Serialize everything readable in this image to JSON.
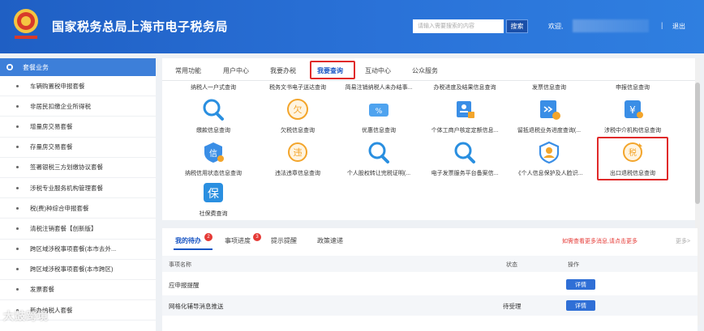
{
  "header": {
    "title": "国家税务总局上海市电子税务局",
    "search_placeholder": "请输入需要搜索的内容",
    "search_button": "搜索",
    "welcome": "欢迎,",
    "separator": "|",
    "logout": "退出",
    "brand_color": "#2a72d8"
  },
  "sidebar": {
    "header": "套餐业务",
    "items": [
      "车辆购置税申报套餐",
      "非居民扣缴企业所得税",
      "增量房交易套餐",
      "存量房交易套餐",
      "签署银税三方划缴协议套餐",
      "涉税专业服务机构管理套餐",
      "税(费)种综合申报套餐",
      "清税注销套餐【创新版】",
      "跨区域涉税事项套餐(本市去外...",
      "跨区域涉税事项套餐(本市跨区)",
      "发票套餐",
      "新办纳税人套餐"
    ]
  },
  "main_tabs": {
    "items": [
      "常用功能",
      "用户中心",
      "我要办税",
      "我要查询",
      "互动中心",
      "公众服务"
    ],
    "active": "我要查询"
  },
  "query_grid": {
    "row1_labels": [
      "纳税人一户式查询",
      "税务文书电子送达查询",
      "简易注销纳税人未办结事...",
      "办税进度及结果信息查询",
      "发票信息查询",
      "申报信息查询"
    ],
    "row2": [
      {
        "label": "缴款信息查询",
        "icon": "search-icon"
      },
      {
        "label": "欠税信息查询",
        "icon": "owed-tax-icon"
      },
      {
        "label": "优惠信息查询",
        "icon": "discount-icon"
      },
      {
        "label": "个体工商户核定定额信息...",
        "icon": "business-license-icon"
      },
      {
        "label": "留抵退税业务进度查询(...",
        "icon": "tax-refund-progress-icon"
      },
      {
        "label": "涉税中介机构信息查询",
        "icon": "agency-icon"
      }
    ],
    "row3": [
      {
        "label": "纳税信用状态信息查询",
        "icon": "credit-icon"
      },
      {
        "label": "违法违章信息查询",
        "icon": "violation-icon"
      },
      {
        "label": "个人股权转让完税证明(...",
        "icon": "search-icon"
      },
      {
        "label": "电子发票服务平台备案信...",
        "icon": "search-icon"
      },
      {
        "label": "《个人信息保护及人脸识...",
        "icon": "face-id-icon"
      },
      {
        "label": "出口退税信息查询",
        "icon": "export-refund-icon"
      }
    ],
    "row4": [
      {
        "label": "社保费查询",
        "icon": "social-security-icon"
      }
    ]
  },
  "bottom": {
    "tabs": [
      {
        "label": "我的待办",
        "badge": "2"
      },
      {
        "label": "事项进度",
        "badge": "3"
      },
      {
        "label": "提示提醒",
        "badge": ""
      },
      {
        "label": "政策速递",
        "badge": ""
      }
    ],
    "more_message": "如需查看更多消息,请点击更多",
    "more_link": "更多>",
    "table": {
      "headers": [
        "事项名称",
        "状态",
        "操作"
      ],
      "rows": [
        {
          "name": "应申报提醒",
          "status": "",
          "action": "详情"
        },
        {
          "name": "网格化辅导消息推送",
          "status": "待受理",
          "action": "详情"
        }
      ]
    }
  },
  "watermark": "大鼓跨境"
}
